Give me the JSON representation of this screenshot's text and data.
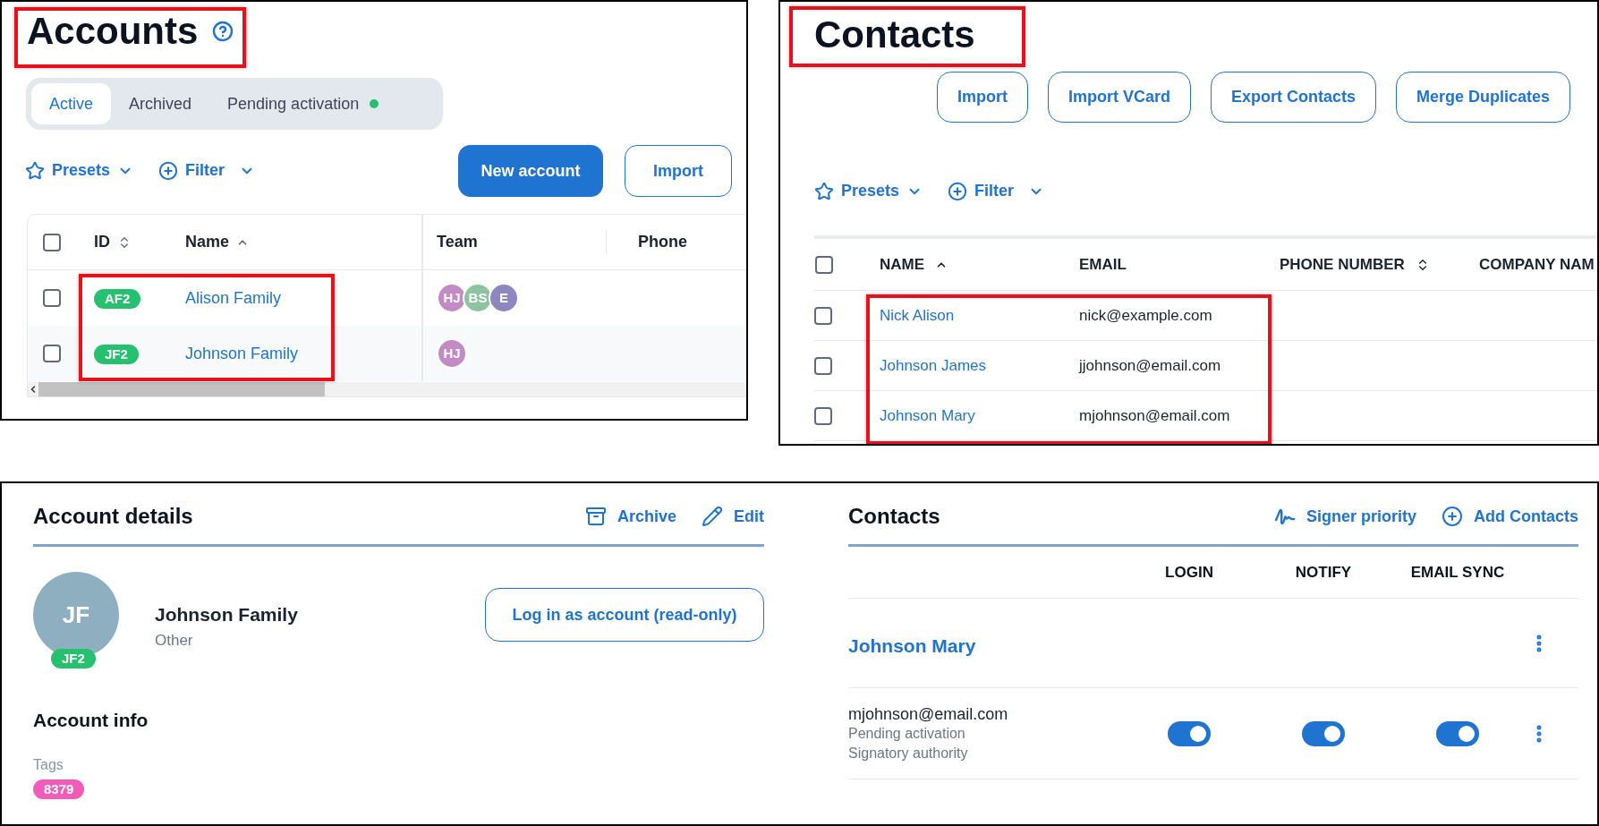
{
  "accounts_panel": {
    "title": "Accounts",
    "tabs": [
      {
        "label": "Active",
        "selected": true,
        "dot": false
      },
      {
        "label": "Archived",
        "selected": false,
        "dot": false
      },
      {
        "label": "Pending activation",
        "selected": false,
        "dot": true
      }
    ],
    "presets": "Presets",
    "filter": "Filter",
    "buttons": [
      {
        "label": "New account",
        "kind": "primary"
      },
      {
        "label": "Import",
        "kind": "outline"
      }
    ],
    "table": {
      "select_all": false,
      "columns": [
        "ID",
        "Name",
        "Team",
        "Phone"
      ],
      "rows": [
        {
          "checked": false,
          "id": "AF2",
          "name": "Alison Family",
          "team": [
            {
              "initials": "HJ",
              "color": "#c38bc4"
            },
            {
              "initials": "BS",
              "color": "#8dc3a0"
            },
            {
              "initials": "E",
              "color": "#8d86c0"
            }
          ]
        },
        {
          "checked": false,
          "id": "JF2",
          "name": "Johnson Family",
          "team": [
            {
              "initials": "HJ",
              "color": "#c38bc4"
            }
          ]
        }
      ]
    }
  },
  "contacts_panel": {
    "title": "Contacts",
    "buttons": [
      "Import",
      "Import VCard",
      "Export Contacts",
      "Merge Duplicates"
    ],
    "presets": "Presets",
    "filter": "Filter",
    "table": {
      "select_all": false,
      "columns": [
        "NAME",
        "EMAIL",
        "PHONE NUMBER",
        "COMPANY NAM"
      ],
      "rows": [
        {
          "checked": false,
          "name": "Nick Alison",
          "email": "nick@example.com"
        },
        {
          "checked": false,
          "name": "Johnson James",
          "email": "jjohnson@email.com"
        },
        {
          "checked": false,
          "name": "Johnson Mary",
          "email": "mjohnson@email.com"
        }
      ]
    }
  },
  "account_details": {
    "title": "Account details",
    "actions": [
      "Archive",
      "Edit"
    ],
    "avatar": "JF",
    "badge": "JF2",
    "name": "Johnson Family",
    "type": "Other",
    "login_button": "Log in as account (read-only)",
    "info_title": "Account info",
    "tags_label": "Tags",
    "tags": [
      {
        "label": "8379",
        "color": "#f25cb8"
      }
    ]
  },
  "account_contacts": {
    "title": "Contacts",
    "actions": [
      "Signer priority",
      "Add Contacts"
    ],
    "columns": [
      "LOGIN",
      "NOTIFY",
      "EMAIL SYNC"
    ],
    "contacts": [
      {
        "name": "Johnson Mary",
        "email": "mjohnson@email.com",
        "status": "Pending activation",
        "role": "Signatory authority",
        "login": true,
        "notify": true,
        "email_sync": true
      }
    ]
  }
}
